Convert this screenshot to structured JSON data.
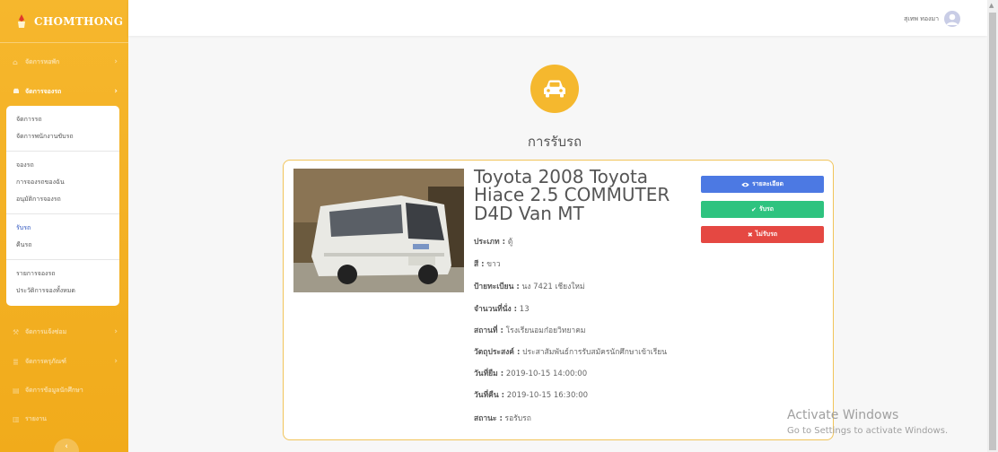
{
  "brand": {
    "name": "CHOMTHONG",
    "color": "#f3b02a"
  },
  "sidebar": {
    "menu": [
      {
        "label": "จัดการหอพัก",
        "icon": "home-icon"
      },
      {
        "label": "จัดการจองรถ",
        "icon": "car-icon"
      },
      {
        "label": "จัดการแจ้งซ่อม",
        "icon": "wrench-icon"
      },
      {
        "label": "จัดการครุภัณฑ์",
        "icon": "list-icon"
      },
      {
        "label": "จัดการข้อมูลนักศึกษา",
        "icon": "id-card-icon"
      },
      {
        "label": "รายงาน",
        "icon": "chart-icon"
      }
    ],
    "submenu": [
      {
        "label": "จัดการรถ"
      },
      {
        "label": "จัดการพนักงานขับรถ"
      },
      {
        "label": "จองรถ"
      },
      {
        "label": "การจองรถของฉัน"
      },
      {
        "label": "อนุมัติการจองรถ"
      },
      {
        "label": "รับรถ"
      },
      {
        "label": "คืนรถ"
      },
      {
        "label": "รายการจองรถ"
      },
      {
        "label": "ประวัติการจองทั้งหมด"
      }
    ]
  },
  "header": {
    "user_name": "สุเทพ ทองมา"
  },
  "page": {
    "title": "การรับรถ"
  },
  "car": {
    "name": "Toyota 2008 Toyota Hiace 2.5 COMMUTER D4D Van MT",
    "fields": [
      {
        "label": "ประเภท :",
        "value": "ตู้"
      },
      {
        "label": "สี :",
        "value": "ขาว"
      },
      {
        "label": "ป้ายทะเบียน :",
        "value": "นง 7421 เชียงใหม่"
      },
      {
        "label": "จำนวนที่นั่ง :",
        "value": "13"
      },
      {
        "label": "สถานที่ :",
        "value": "โรงเรียนอมก๋อยวิทยาคม"
      },
      {
        "label": "วัตถุประสงค์ :",
        "value": "ประสาสัมพันธ์การรับสมัครนักศึกษาเข้าเรียน"
      },
      {
        "label": "วันที่ยืม :",
        "value": "2019-10-15 14:00:00"
      },
      {
        "label": "วันที่คืน :",
        "value": "2019-10-15 16:30:00"
      },
      {
        "label": "สถานะ :",
        "value": "รอรับรถ"
      }
    ]
  },
  "buttons": {
    "detail": "รายละเอียด",
    "receive": "รับรถ",
    "reject": "ไม่รับรถ"
  },
  "colors": {
    "accent": "#f5b82e",
    "detail": "#4c79e3",
    "receive": "#2ec37f",
    "reject": "#e54842"
  },
  "watermark": {
    "title": "Activate Windows",
    "subtitle": "Go to Settings to activate Windows."
  }
}
